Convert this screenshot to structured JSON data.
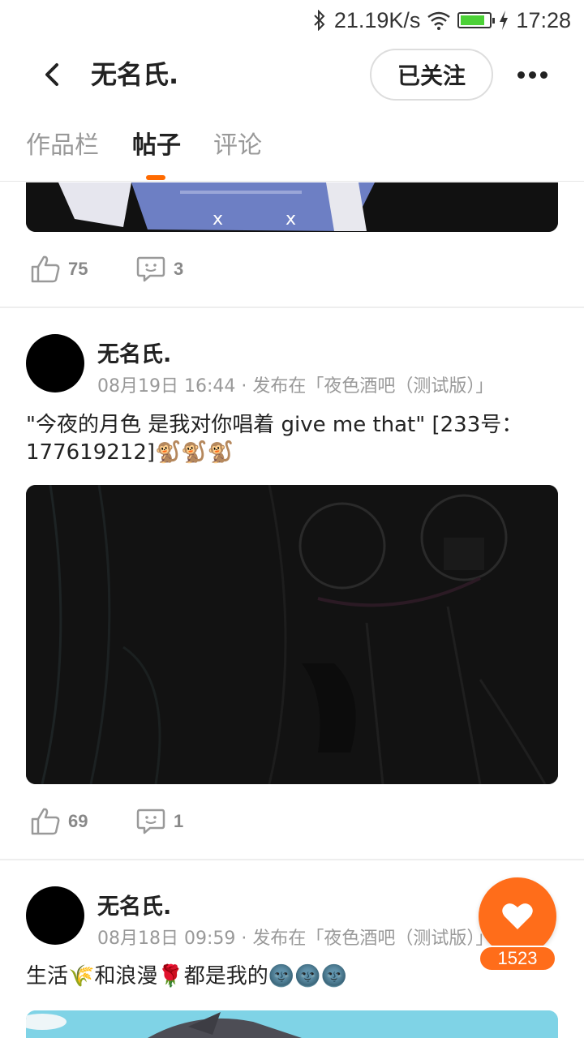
{
  "status_bar": {
    "net_speed": "21.19K/s",
    "time": "17:28",
    "icons": [
      "bluetooth-icon",
      "wifi-icon",
      "battery-icon",
      "charging-icon"
    ]
  },
  "header": {
    "title": "无名氏.",
    "follow_label": "已关注",
    "back_icon": "chevron-left-icon",
    "more_icon": "more-dots-icon"
  },
  "tabs": [
    {
      "label": "作品栏",
      "active": false
    },
    {
      "label": "帖子",
      "active": true
    },
    {
      "label": "评论",
      "active": false
    }
  ],
  "accent_color": "#ff6a00",
  "posts": [
    {
      "likes": "75",
      "comments": "3"
    },
    {
      "author": "无名氏.",
      "date": "08月19日 16:44",
      "published_in": "· 发布在「夜色酒吧（测试版）」",
      "text": "\"今夜的月色 是我对你唱着 give me that\" [233号：177619212]🐒🐒🐒",
      "likes": "69",
      "comments": "1"
    },
    {
      "author": "无名氏.",
      "date": "08月18日 09:59",
      "published_in": "· 发布在「夜色酒吧（测试版）」",
      "text": "生活🌾和浪漫🌹都是我的🌚🌚🌚"
    }
  ],
  "fab": {
    "icon": "heart-icon",
    "count": "1523"
  }
}
